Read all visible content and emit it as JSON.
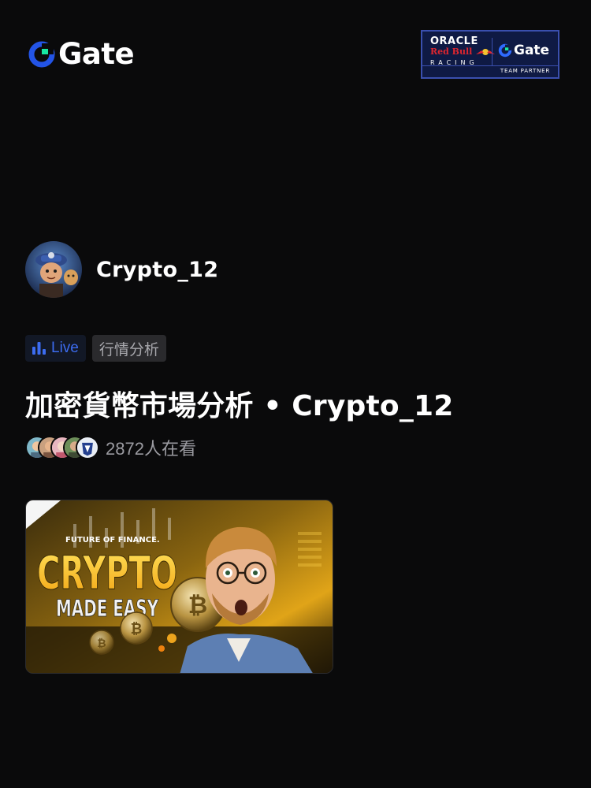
{
  "header": {
    "logo_text": "Gate",
    "brand_color": "#2354e6",
    "accent_color": "#17e6a1",
    "partner_badge": {
      "oracle": "ORACLE",
      "red_bull": "Red Bull",
      "racing": "RACING",
      "gate": "Gate",
      "footer": "TEAM PARTNER"
    }
  },
  "streamer": {
    "name": "Crypto_12",
    "avatar_icon": "cartoon-character-avatar"
  },
  "tags": {
    "live_label": "Live",
    "live_icon": "bar-chart-icon",
    "live_color": "#3c6cf0",
    "category": "行情分析"
  },
  "stream": {
    "title": "加密貨幣市場分析 • Crypto_12",
    "viewer_count": "2872人在看"
  },
  "thumbnail": {
    "kicker": "FUTURE OF FINANCE.",
    "headline": "CRYPTO",
    "subheadline": "MADE EASY"
  }
}
